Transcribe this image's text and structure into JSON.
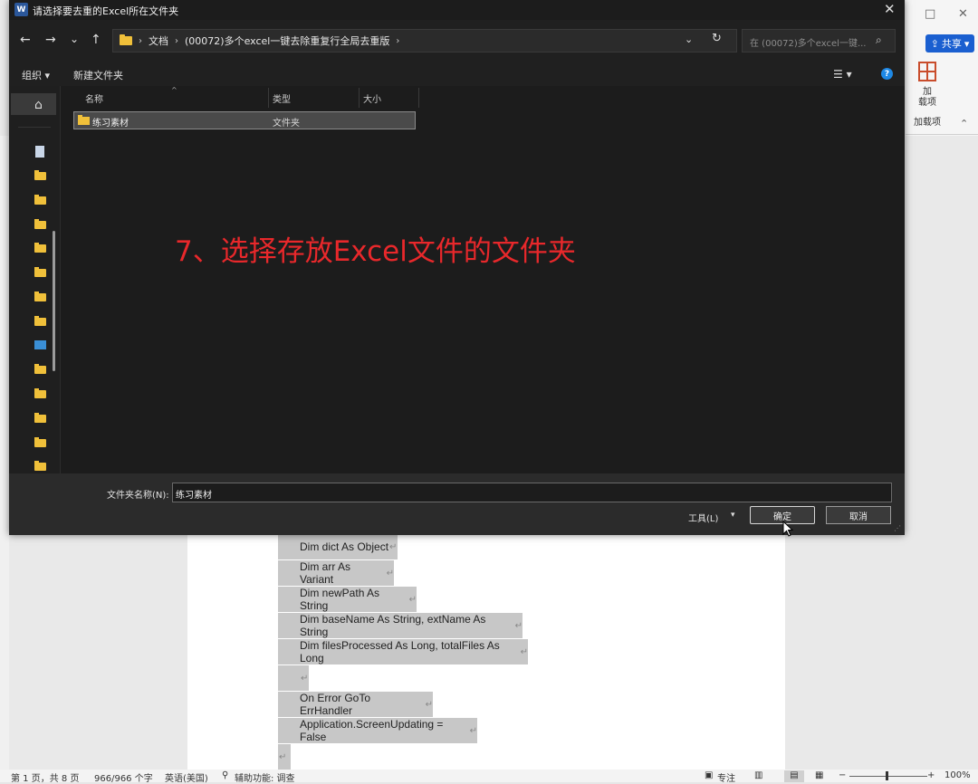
{
  "dialog": {
    "title": "请选择要去重的Excel所在文件夹",
    "app_icon_letter": "W",
    "close_glyph": "✕",
    "nav": {
      "back": "←",
      "forward": "→",
      "recent": "⌄",
      "up": "↑"
    },
    "breadcrumb": [
      "文档",
      "(00072)多个excel一键去除重复行全局去重版"
    ],
    "breadcrumb_trailing": "›",
    "address_dropdown": "⌄",
    "refresh": "↻",
    "search_placeholder": "在 (00072)多个excel一键...",
    "search_icon": "⌕",
    "toolbar": {
      "organize": "组织 ▾",
      "new_folder": "新建文件夹",
      "view": "☰ ▾",
      "help": "?"
    },
    "columns": {
      "name": "名称",
      "type": "类型",
      "size": "大小"
    },
    "files": [
      {
        "name": "练习素材",
        "type": "文件夹"
      }
    ],
    "annotation": "7、选择存放Excel文件的文件夹",
    "filename_label": "文件夹名称(N):",
    "filename_value": "练习素材",
    "tools_label": "工具(L)",
    "tools_dropdown": "▾",
    "ok_label": "确定",
    "cancel_label": "取消",
    "home_glyph": "⌂",
    "grip": "⋰"
  },
  "word": {
    "window_controls": {
      "restore": "□",
      "close": "✕"
    },
    "share_label": "共享",
    "addin_label_1": "加",
    "addin_label_2": "载项",
    "addin_group": "加载项",
    "collapse": "⌃",
    "code_lines": [
      "Dim dict As Object",
      "Dim arr As Variant",
      "Dim newPath As String",
      "Dim baseName As String, extName As String",
      "Dim filesProcessed As Long, totalFiles As Long",
      "",
      "On Error GoTo ErrHandler",
      "Application.ScreenUpdating = False",
      ""
    ],
    "para_mark": "↵",
    "status": {
      "page": "第 1 页，共 8 页",
      "words": "966/966 个字",
      "language": "英语(美国)",
      "accessibility": "辅助功能: 调查",
      "focus": "专注",
      "zoom_minus": "−",
      "zoom_plus": "+",
      "zoom": "100%"
    }
  },
  "colors": {
    "accent_blue": "#1a5fd0",
    "folder_yellow": "#f0c03a",
    "annotation_red": "#e8282b"
  }
}
